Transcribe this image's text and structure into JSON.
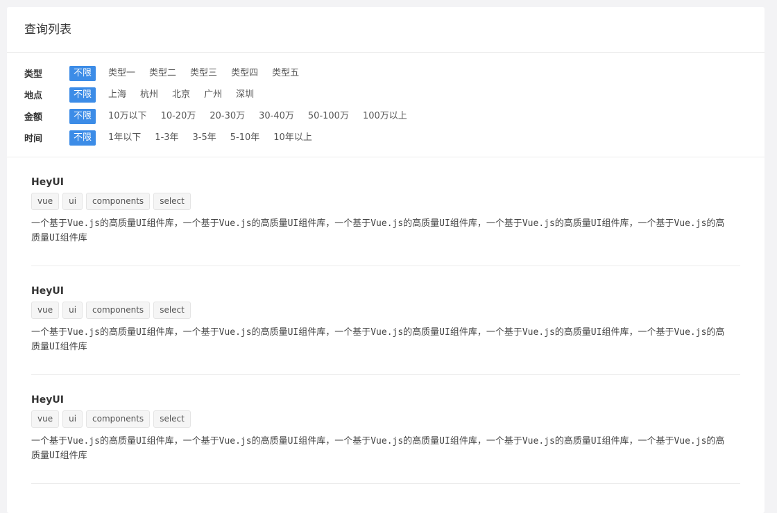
{
  "card": {
    "title": "查询列表"
  },
  "filters": [
    {
      "label": "类型",
      "options": [
        "不限",
        "类型一",
        "类型二",
        "类型三",
        "类型四",
        "类型五"
      ],
      "selected": 0
    },
    {
      "label": "地点",
      "options": [
        "不限",
        "上海",
        "杭州",
        "北京",
        "广州",
        "深圳"
      ],
      "selected": 0
    },
    {
      "label": "金额",
      "options": [
        "不限",
        "10万以下",
        "10-20万",
        "20-30万",
        "30-40万",
        "50-100万",
        "100万以上"
      ],
      "selected": 0
    },
    {
      "label": "时间",
      "options": [
        "不限",
        "1年以下",
        "1-3年",
        "3-5年",
        "5-10年",
        "10年以上"
      ],
      "selected": 0
    }
  ],
  "items": [
    {
      "title": "HeyUI",
      "tags": [
        "vue",
        "ui",
        "components",
        "select"
      ],
      "desc": "一个基于Vue.js的高质量UI组件库，一个基于Vue.js的高质量UI组件库，一个基于Vue.js的高质量UI组件库，一个基于Vue.js的高质量UI组件库，一个基于Vue.js的高质量UI组件库"
    },
    {
      "title": "HeyUI",
      "tags": [
        "vue",
        "ui",
        "components",
        "select"
      ],
      "desc": "一个基于Vue.js的高质量UI组件库，一个基于Vue.js的高质量UI组件库，一个基于Vue.js的高质量UI组件库，一个基于Vue.js的高质量UI组件库，一个基于Vue.js的高质量UI组件库"
    },
    {
      "title": "HeyUI",
      "tags": [
        "vue",
        "ui",
        "components",
        "select"
      ],
      "desc": "一个基于Vue.js的高质量UI组件库，一个基于Vue.js的高质量UI组件库，一个基于Vue.js的高质量UI组件库，一个基于Vue.js的高质量UI组件库，一个基于Vue.js的高质量UI组件库"
    }
  ],
  "colors": {
    "accent": "#3c8ce7",
    "background": "#f3f3f5",
    "card": "#ffffff"
  }
}
